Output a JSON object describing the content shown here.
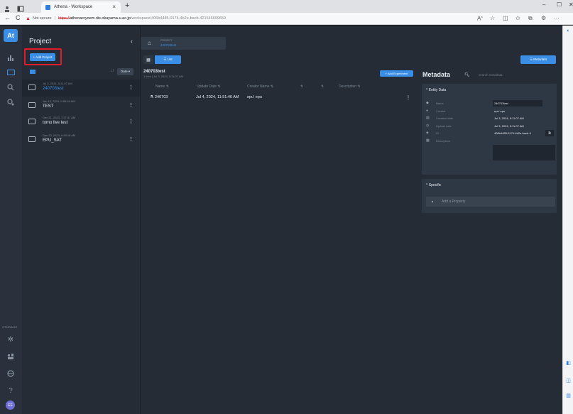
{
  "browser": {
    "tab_title": "Athena - Workspace",
    "tab_close": "×",
    "new_tab": "+",
    "minimize": "–",
    "maximize": "☐",
    "close": "✕",
    "back": "←",
    "reload": "C",
    "warning_glyph": "▲",
    "not_secure": "Not secure",
    "url_https": "https://",
    "url_host": "athenacryoem.riis.okayama-u.ac.jp",
    "url_path": "/workspace/406b4485-0174-4b2e-bacb-421546699659",
    "toolbar_icons": [
      "read-aloud-icon",
      "favorite-icon",
      "split-icon",
      "favorites-bar-icon",
      "collections-icon",
      "extensions-icon",
      "more-icon"
    ]
  },
  "rail": {
    "logo": "At",
    "icons": [
      "chart-icon",
      "folder-icon",
      "search-icon",
      "jobs-icon"
    ],
    "storage_label": "STORAGE",
    "bottom_icons": [
      "network-icon",
      "tools-icon",
      "globe-icon",
      "help-icon"
    ],
    "user_initials": "EE"
  },
  "project_panel": {
    "title": "Project",
    "collapse_glyph": "‹",
    "add_button": "+ Add Project",
    "sort_glyph": "↓↑",
    "sort_value": "Date ▾",
    "items": [
      {
        "date": "Jul 3, 2024, 5:11:07 AM",
        "name": "240703test",
        "selected": true
      },
      {
        "date": "Jan 10, 2024, 6:55:18 AM",
        "name": "TEST",
        "selected": false
      },
      {
        "date": "Dec 21, 2023, 7:27:41 AM",
        "name": "tomo live test",
        "selected": false
      },
      {
        "date": "Dec 20, 2023, 6:59:16 AM",
        "name": "EPU_SAT",
        "selected": false
      }
    ]
  },
  "breadcrumb": {
    "label": "PROJECT",
    "name": "240703test"
  },
  "view_toggle": {
    "grid_glyph": "▦",
    "list_label": "☰  List"
  },
  "metadata_button": "☰  Metadata",
  "experiments": {
    "title": "240703test",
    "subtitle": "1 item  |  Jul 3, 2024, 5:11:07 AM",
    "add_button": "+ Add Experiment",
    "columns": [
      "Name ⇅",
      "Update Date ⇅",
      "Creator Name ⇅",
      "⇅",
      "⇅",
      "Description ⇅"
    ],
    "rows": [
      {
        "name": "240703",
        "update_date": "Jul 4, 2024, 11:51:46 AM",
        "creator": "epu' epu"
      }
    ]
  },
  "metadata": {
    "title": "Metadata",
    "search_placeholder": "search metadata",
    "entity_header": "^  Entity Data",
    "fields": [
      {
        "icon": "tag-icon",
        "label": "Name",
        "value": "240703test"
      },
      {
        "icon": "person-icon",
        "label": "Creator",
        "value": "epu' epu"
      },
      {
        "icon": "calendar-icon",
        "label": "Creation date",
        "value": "Jul 3, 2024, 5:11:07 AM"
      },
      {
        "icon": "clock-icon",
        "label": "Update date",
        "value": "Jul 3, 2024, 5:11:07 AM"
      },
      {
        "icon": "id-icon",
        "label": "ID",
        "value": "406b4485-0174-4b2e-bacb-4"
      },
      {
        "icon": "description-icon",
        "label": "Description",
        "value": ""
      }
    ],
    "specific_header": "^  Specific",
    "add_property": "Add a Property"
  }
}
